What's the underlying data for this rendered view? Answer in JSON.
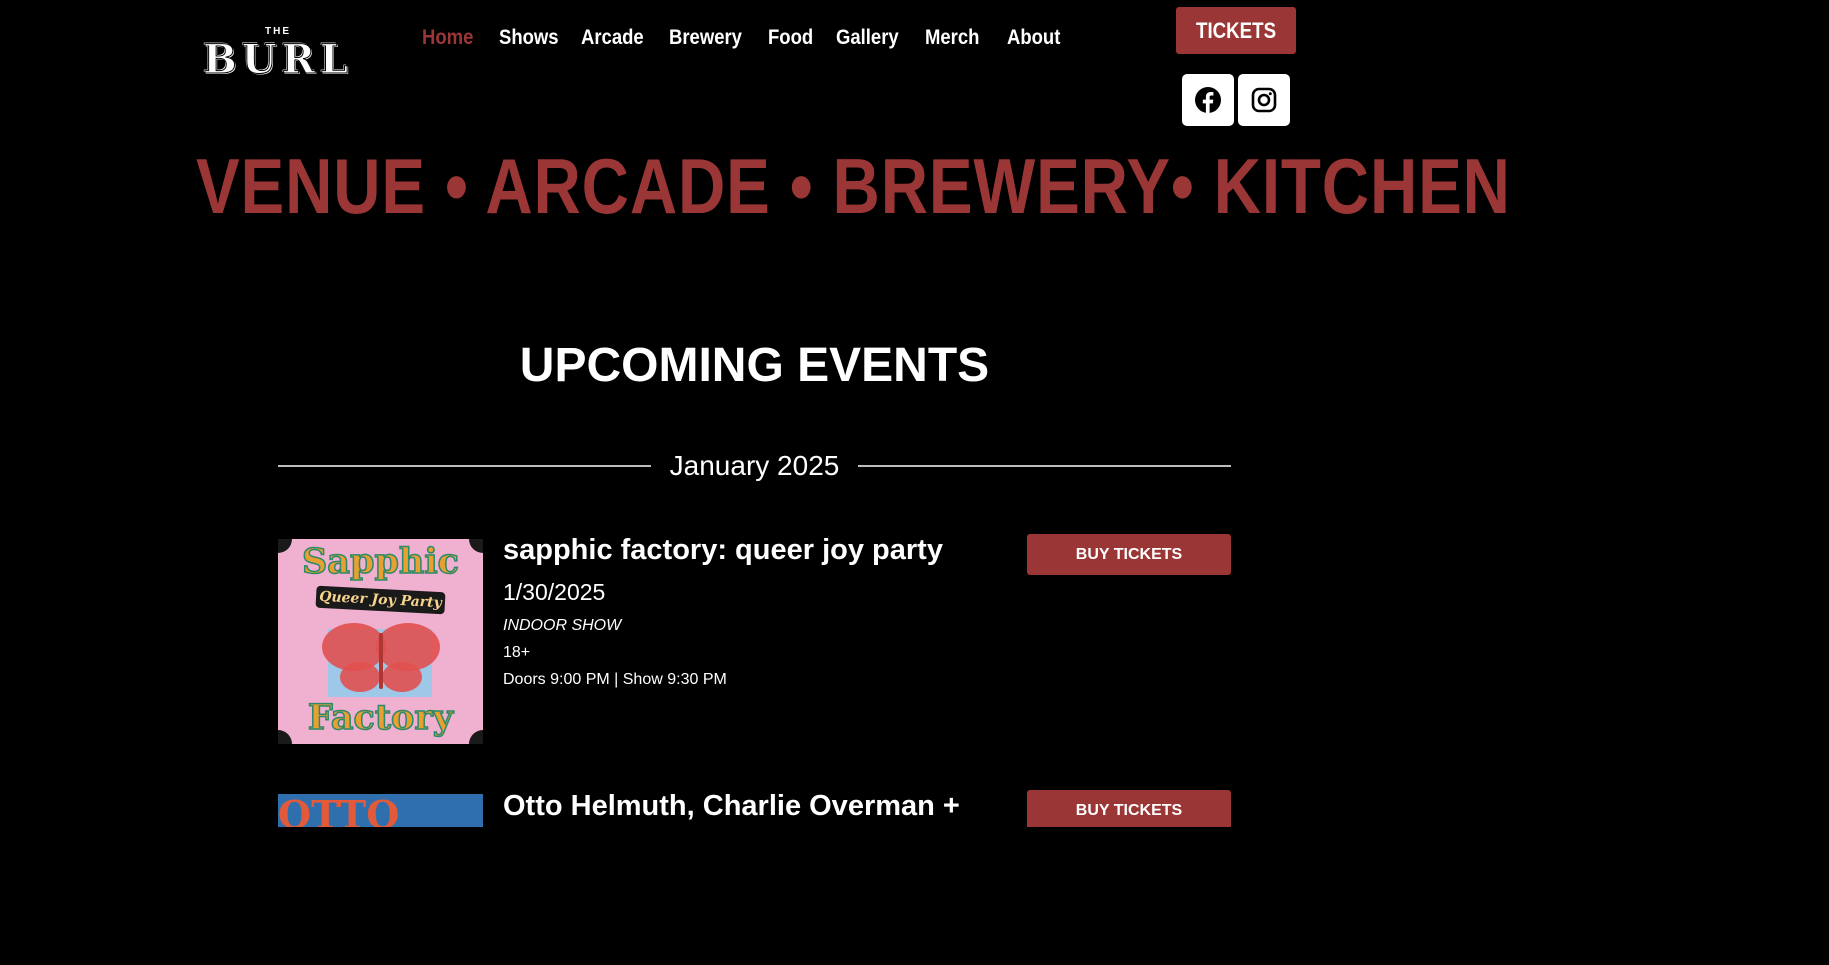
{
  "header": {
    "logo_small": "THE",
    "logo_large": "BURL",
    "nav": [
      {
        "label": "Home",
        "active": true
      },
      {
        "label": "Shows",
        "active": false
      },
      {
        "label": "Arcade",
        "active": false
      },
      {
        "label": "Brewery",
        "active": false
      },
      {
        "label": "Food",
        "active": false
      },
      {
        "label": "Gallery",
        "active": false
      },
      {
        "label": "Merch",
        "active": false
      },
      {
        "label": "About",
        "active": false
      }
    ],
    "tickets_label": "TICKETS",
    "social": [
      {
        "icon": "facebook-icon"
      },
      {
        "icon": "instagram-icon"
      }
    ]
  },
  "tagline": "VENUE • ARCADE • BREWERY• KITCHEN",
  "events": {
    "heading": "UPCOMING EVENTS",
    "month": "January 2025",
    "items": [
      {
        "title": "sapphic factory: queer joy party",
        "date": "1/30/2025",
        "type": "INDOOR SHOW",
        "age": "18+",
        "times": "Doors 9:00 PM | Show 9:30 PM",
        "button": "BUY TICKETS",
        "poster": {
          "top_text": "Sapphic",
          "band_text": "Queer Joy Party",
          "bottom_text": "Factory"
        }
      },
      {
        "title": "Otto Helmuth, Charlie Overman +",
        "button": "BUY TICKETS",
        "poster": {
          "top_text": "OTTO"
        }
      }
    ]
  },
  "colors": {
    "accent": "#9b3636",
    "background": "#000000",
    "text": "#ffffff"
  }
}
